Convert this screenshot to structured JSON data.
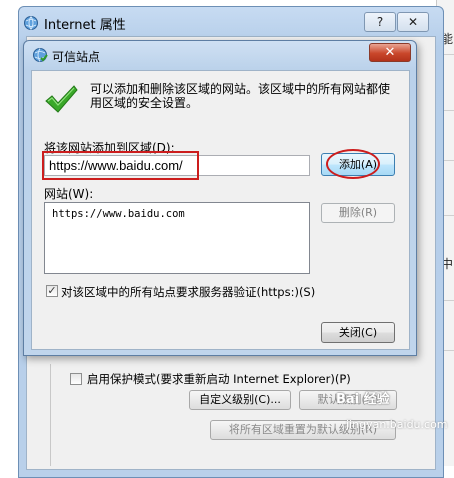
{
  "outer_window": {
    "title": "Internet 属性",
    "help_button": "?",
    "close_button": "✕",
    "protected_mode_label": "启用保护模式(要求重新启动 Internet Explorer)(P)",
    "custom_level_button": "自定义级别(C)...",
    "default_level_button": "默认级别(D)",
    "reset_all_button": "将所有区域重置为默认级别(R)"
  },
  "background_app": {
    "chars": [
      "能",
      "中"
    ]
  },
  "dialog": {
    "title": "可信站点",
    "close_button": "✕",
    "description": "可以添加和删除该区域的网站。该区域中的所有网站都使用区域的安全设置。",
    "add_label": "将该网站添加到区域(D):",
    "url_value": "https://www.baidu.com/",
    "add_button": "添加(A)",
    "websites_label": "网站(W):",
    "websites": [
      "https://www.baidu.com"
    ],
    "remove_button": "删除(R)",
    "require_https_label": "对该区域中的所有站点要求服务器验证(https:)(S)",
    "require_https_checked": true,
    "close_dialog_button": "关闭(C)"
  },
  "watermark": {
    "text": "Bai 经验",
    "url": "jingyan.baidu.com"
  },
  "colors": {
    "annotation_red": "#cc1d1d",
    "checkmark_green": "#3aa829",
    "close_red": "#c9472b"
  }
}
